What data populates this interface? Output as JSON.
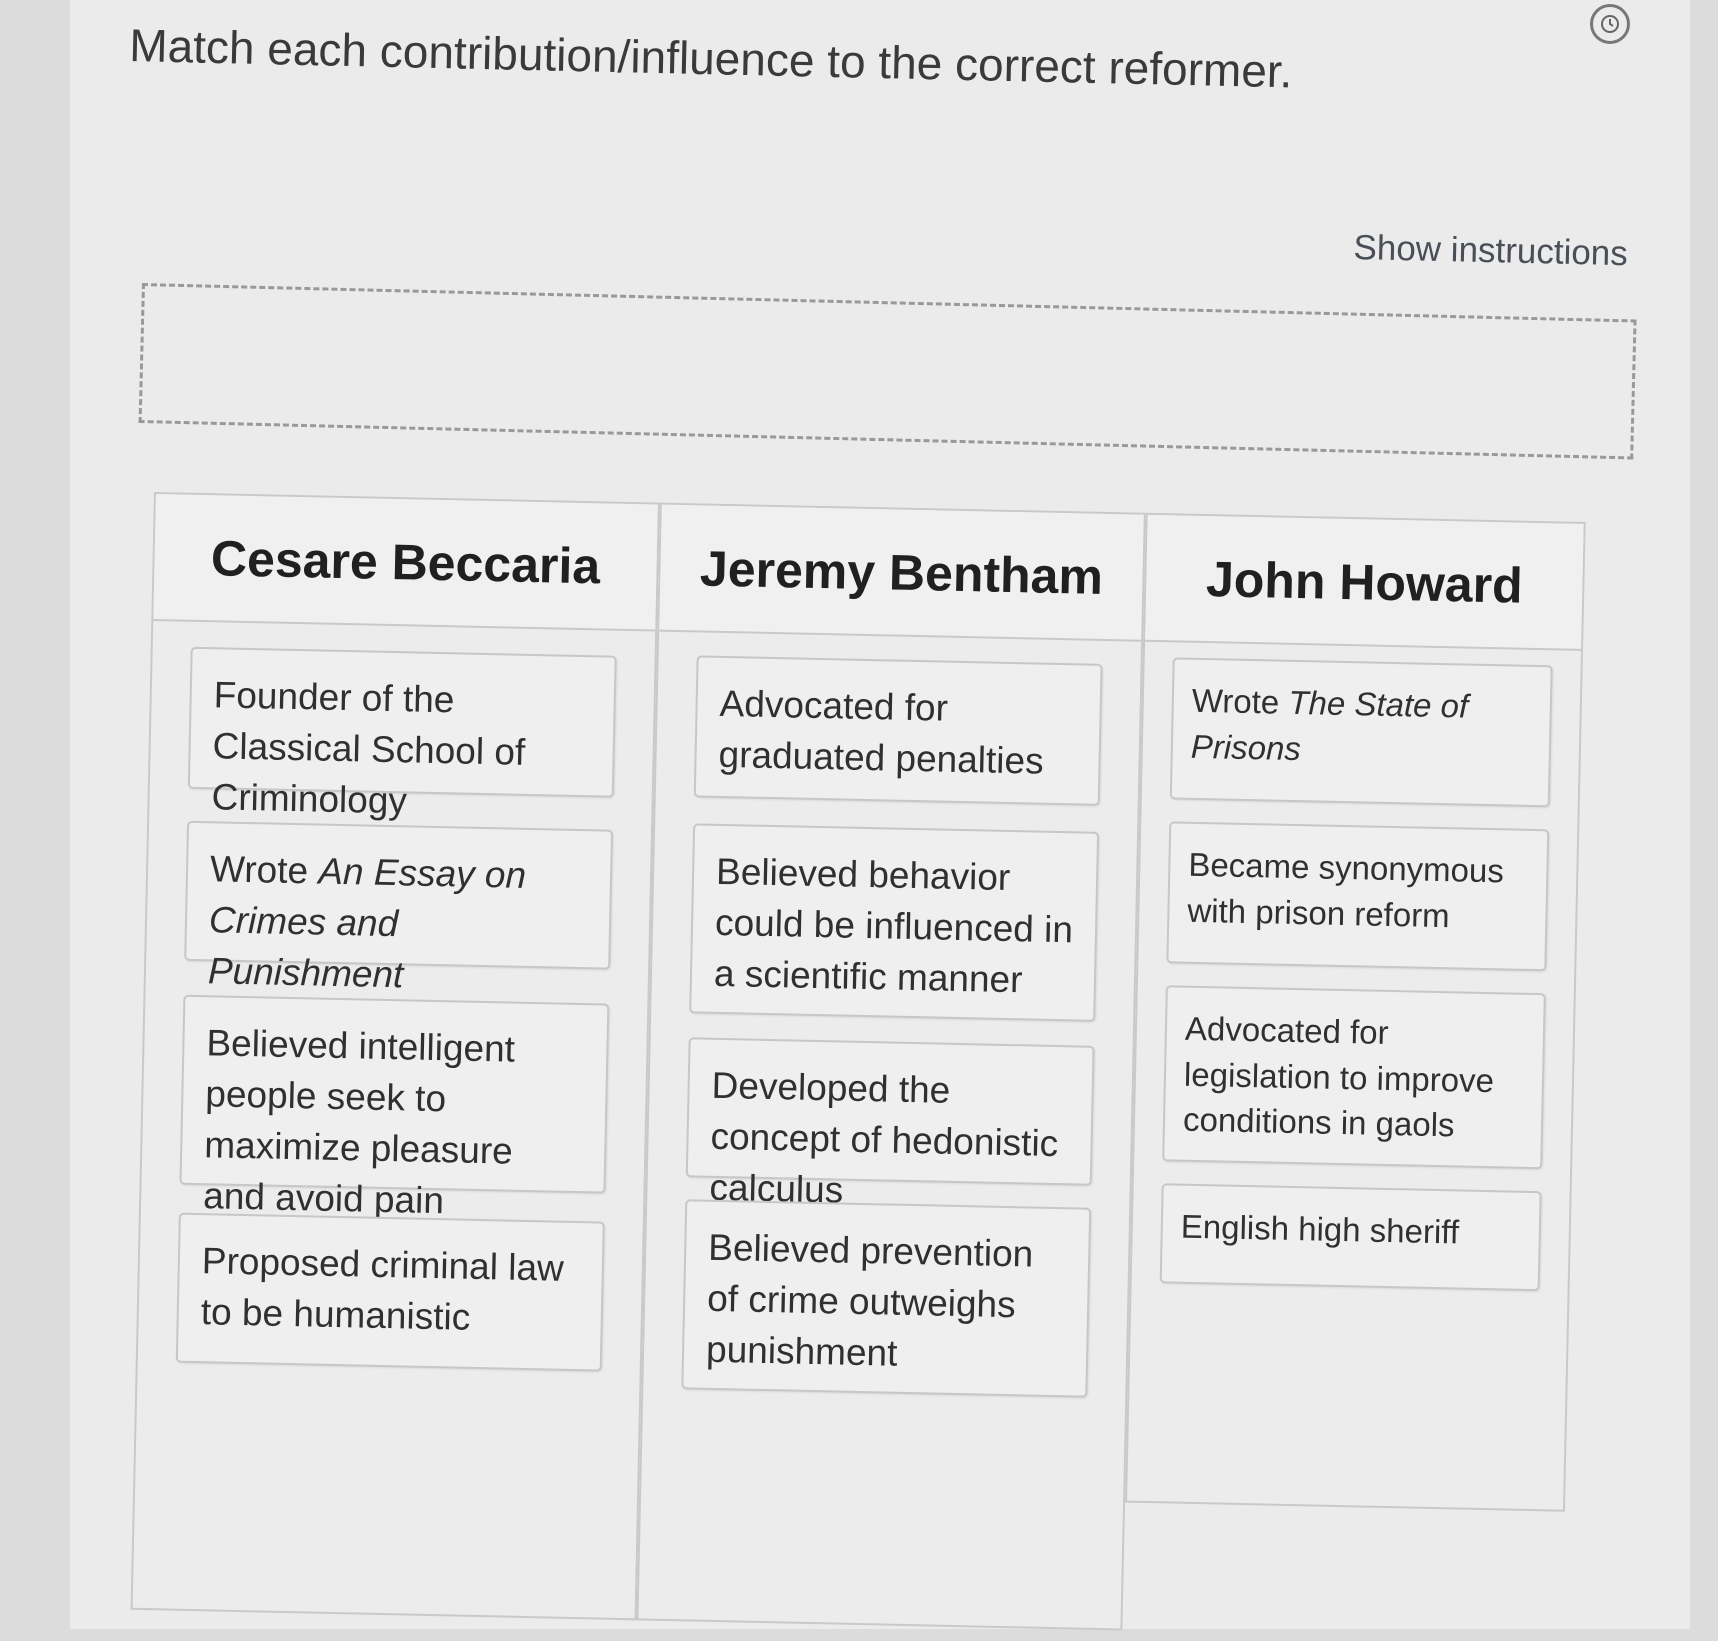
{
  "question": "Match each contribution/influence to the correct reformer.",
  "show_instructions": "Show instructions",
  "history_icon": "history-icon",
  "columns": {
    "beccaria": {
      "title": "Cesare Beccaria",
      "cards": {
        "c1": "Founder of the Classical School of Criminology",
        "c2_pre": "Wrote ",
        "c2_italic": "An Essay on Crimes and Punishment",
        "c3": "Believed intelligent people seek to maximize pleasure and avoid pain",
        "c4": "Proposed criminal law to be humanistic"
      }
    },
    "bentham": {
      "title": "Jeremy Bentham",
      "cards": {
        "c1": "Advocated for graduated penalties",
        "c2": "Believed behavior could be influenced in a scientific manner",
        "c3": "Developed the concept of hedonistic calculus",
        "c4": "Believed prevention of crime outweighs punishment"
      }
    },
    "howard": {
      "title": "John Howard",
      "cards": {
        "c1_pre": "Wrote ",
        "c1_italic": "The State of Prisons",
        "c2": "Became synonymous with prison reform",
        "c3": "Advocated for legislation to improve conditions in gaols",
        "c4": "English high sheriff"
      }
    }
  }
}
